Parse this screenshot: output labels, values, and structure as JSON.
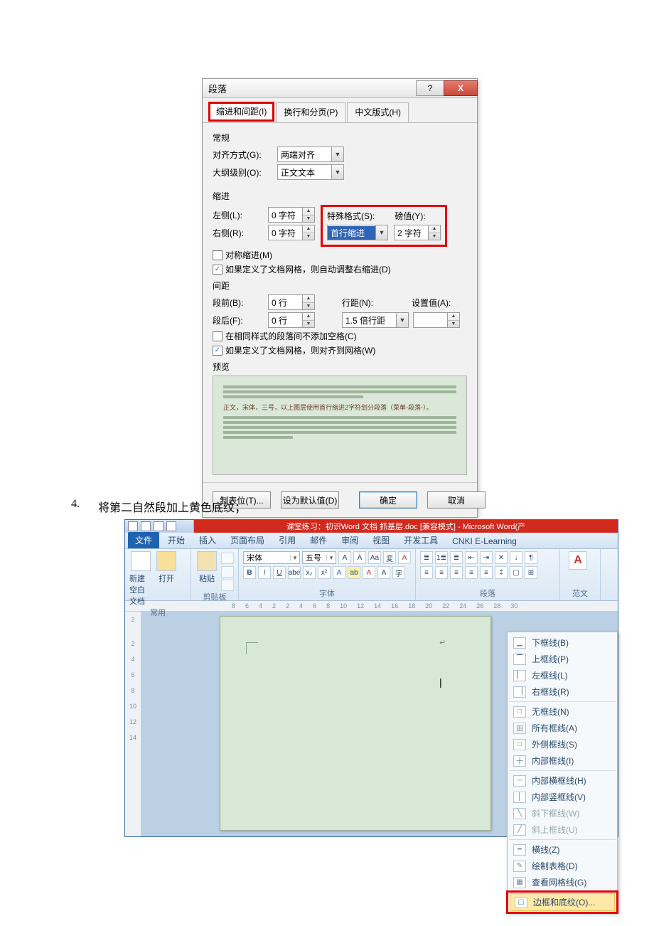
{
  "dialog": {
    "title": "段落",
    "tabs": {
      "t1": "缩进和间距(I)",
      "t2": "换行和分页(P)",
      "t3": "中文版式(H)"
    },
    "general": {
      "heading": "常规",
      "align_lbl": "对齐方式(G):",
      "align_val": "两端对齐",
      "outline_lbl": "大纲级别(O):",
      "outline_val": "正文文本"
    },
    "indent": {
      "heading": "缩进",
      "left_lbl": "左侧(L):",
      "left_val": "0 字符",
      "right_lbl": "右侧(R):",
      "right_val": "0 字符",
      "special_lbl": "特殊格式(S):",
      "special_val": "首行缩进",
      "by_lbl": "磅值(Y):",
      "by_val": "2 字符",
      "mirror": "对称缩进(M)",
      "autogrid": "如果定义了文档网格，则自动调整右缩进(D)"
    },
    "spacing": {
      "heading": "间距",
      "before_lbl": "段前(B):",
      "before_val": "0 行",
      "after_lbl": "段后(F):",
      "after_val": "0 行",
      "line_lbl": "行距(N):",
      "line_val": "1.5 倍行距",
      "at_lbl": "设置值(A):",
      "at_val": "",
      "nospace": "在相同样式的段落间不添加空格(C)",
      "snapgrid": "如果定义了文档网格，则对齐到网格(W)"
    },
    "preview": {
      "heading": "预览",
      "sample": "正文，宋体，三号，以上图层使用首行缩进2字符划分段落（菜单-段落-）。"
    },
    "footer": {
      "tabs": "制表位(T)...",
      "default": "设为默认值(D)",
      "ok": "确定",
      "cancel": "取消"
    }
  },
  "instruction": {
    "num": "4.",
    "text": "将第二自然段加上黄色底纹；"
  },
  "word": {
    "titlebar": "课堂练习：初识Word 文档 抓基层.doc [兼容模式] - Microsoft Word(产",
    "tabs": {
      "file": "文件",
      "home": "开始",
      "insert": "插入",
      "layout": "页面布局",
      "ref": "引用",
      "mail": "邮件",
      "review": "审阅",
      "view": "视图",
      "dev": "开发工具",
      "cnki": "CNKI E-Learning"
    },
    "groups": {
      "common": {
        "label": "常用",
        "newdoc": "新建空白文档",
        "open": "打开"
      },
      "clipboard": {
        "label": "剪贴板",
        "paste": "粘贴"
      },
      "font": {
        "label": "字体",
        "name": "宋体",
        "size": "五号"
      },
      "paragraph": {
        "label": "段落"
      },
      "styles": {
        "label": "范文"
      }
    },
    "borders_menu": {
      "items": [
        "下框线(B)",
        "上框线(P)",
        "左框线(L)",
        "右框线(R)",
        "无框线(N)",
        "所有框线(A)",
        "外侧框线(S)",
        "内部框线(I)",
        "内部横框线(H)",
        "内部竖框线(V)",
        "斜下框线(W)",
        "斜上框线(U)",
        "横线(Z)",
        "绘制表格(D)",
        "查看网格线(G)",
        "边框和底纹(O)..."
      ]
    },
    "ruler_ticks": [
      "8",
      "6",
      "4",
      "2",
      "2",
      "4",
      "6",
      "8",
      "10",
      "12",
      "14",
      "16",
      "18",
      "20",
      "22",
      "24",
      "26",
      "28",
      "30"
    ],
    "vruler_ticks": [
      "2",
      "",
      "2",
      "4",
      "6",
      "8",
      "10",
      "12",
      "14"
    ]
  }
}
